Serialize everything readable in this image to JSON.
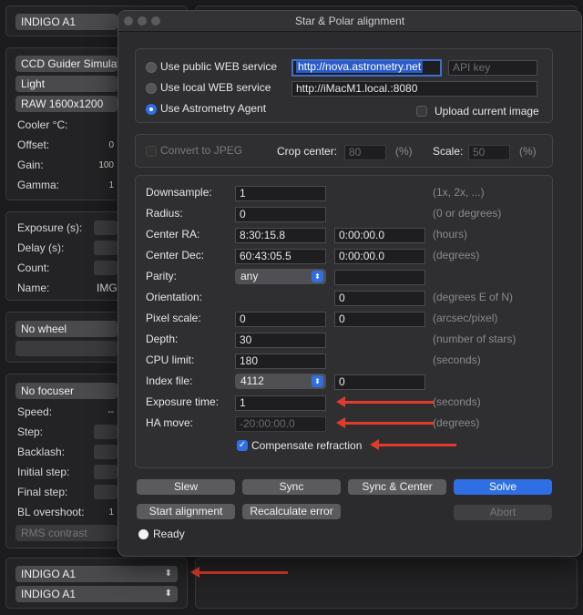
{
  "bg": {
    "top_device": "INDIGO A1",
    "camera": "CCD Guider Simulat",
    "frame_type": "Light",
    "resolution": "RAW 1600x1200",
    "cooler_label": "Cooler °C:",
    "offset_label": "Offset:",
    "offset_value": "0",
    "gain_label": "Gain:",
    "gain_value": "100",
    "gamma_label": "Gamma:",
    "gamma_value": "1",
    "exposure_label": "Exposure (s):",
    "delay_label": "Delay (s):",
    "count_label": "Count:",
    "name_label": "Name:",
    "name_value": "IMG",
    "wheel": "No wheel",
    "focuser": "No focuser",
    "speed_label": "Speed:",
    "speed_value": "--",
    "step_label": "Step:",
    "backlash_label": "Backlash:",
    "initial_step_label": "Initial step:",
    "final_step_label": "Final step:",
    "bl_overshoot_label": "BL overshoot:",
    "bl_overshoot_value": "1",
    "rms_contrast": "RMS contrast",
    "bottom_device_1": "INDIGO A1",
    "bottom_device_2": "INDIGO A1"
  },
  "dialog": {
    "title": "Star & Polar alignment",
    "service": {
      "public_label": "Use public WEB service",
      "public_url": "http://nova.astrometry.net",
      "api_key_placeholder": "API key",
      "local_label": "Use local WEB service",
      "local_url": "http://iMacM1.local.:8080",
      "agent_label": "Use Astrometry Agent",
      "selected": "agent",
      "upload_label": "Upload current image"
    },
    "image": {
      "convert_label": "Convert to JPEG",
      "crop_label": "Crop center:",
      "crop_value": "80",
      "crop_unit": "(%)",
      "scale_label": "Scale:",
      "scale_value": "50",
      "scale_unit": "(%)"
    },
    "params": {
      "downsample_label": "Downsample:",
      "downsample_value": "1",
      "downsample_hint": "(1x, 2x, ...)",
      "radius_label": "Radius:",
      "radius_value": "0",
      "radius_hint": "(0 or degrees)",
      "ra_label": "Center RA:",
      "ra_value": "8:30:15.8",
      "ra_value2": "0:00:00.0",
      "ra_hint": "(hours)",
      "dec_label": "Center Dec:",
      "dec_value": "60:43:05.5",
      "dec_value2": "0:00:00.0",
      "dec_hint": "(degrees)",
      "parity_label": "Parity:",
      "parity_value": "any",
      "orientation_label": "Orientation:",
      "orientation_value": "0",
      "orientation_hint": "(degrees E of N)",
      "pixel_scale_label": "Pixel scale:",
      "pixel_scale_value": "0",
      "pixel_scale_value2": "0",
      "pixel_scale_hint": "(arcsec/pixel)",
      "depth_label": "Depth:",
      "depth_value": "30",
      "depth_hint": "(number of stars)",
      "cpu_label": "CPU limit:",
      "cpu_value": "180",
      "cpu_hint": "(seconds)",
      "index_label": "Index file:",
      "index_value": "4112",
      "index_value2": "0",
      "exposure_label": "Exposure time:",
      "exposure_value": "1",
      "exposure_hint": "(seconds)",
      "ha_label": "HA move:",
      "ha_value": "-20:00:00.0",
      "ha_hint": "(degrees)",
      "refraction_label": "Compensate refraction"
    },
    "buttons": {
      "slew": "Slew",
      "sync": "Sync",
      "sync_center": "Sync & Center",
      "solve": "Solve",
      "start_alignment": "Start alignment",
      "recalculate": "Recalculate error",
      "abort": "Abort"
    },
    "status": "Ready"
  },
  "colors": {
    "accent": "#2f6fe3",
    "annotation_arrow": "#e23b2e"
  },
  "icons": [
    "chevron-updown-icon",
    "checkmark-icon",
    "red-arrow"
  ]
}
